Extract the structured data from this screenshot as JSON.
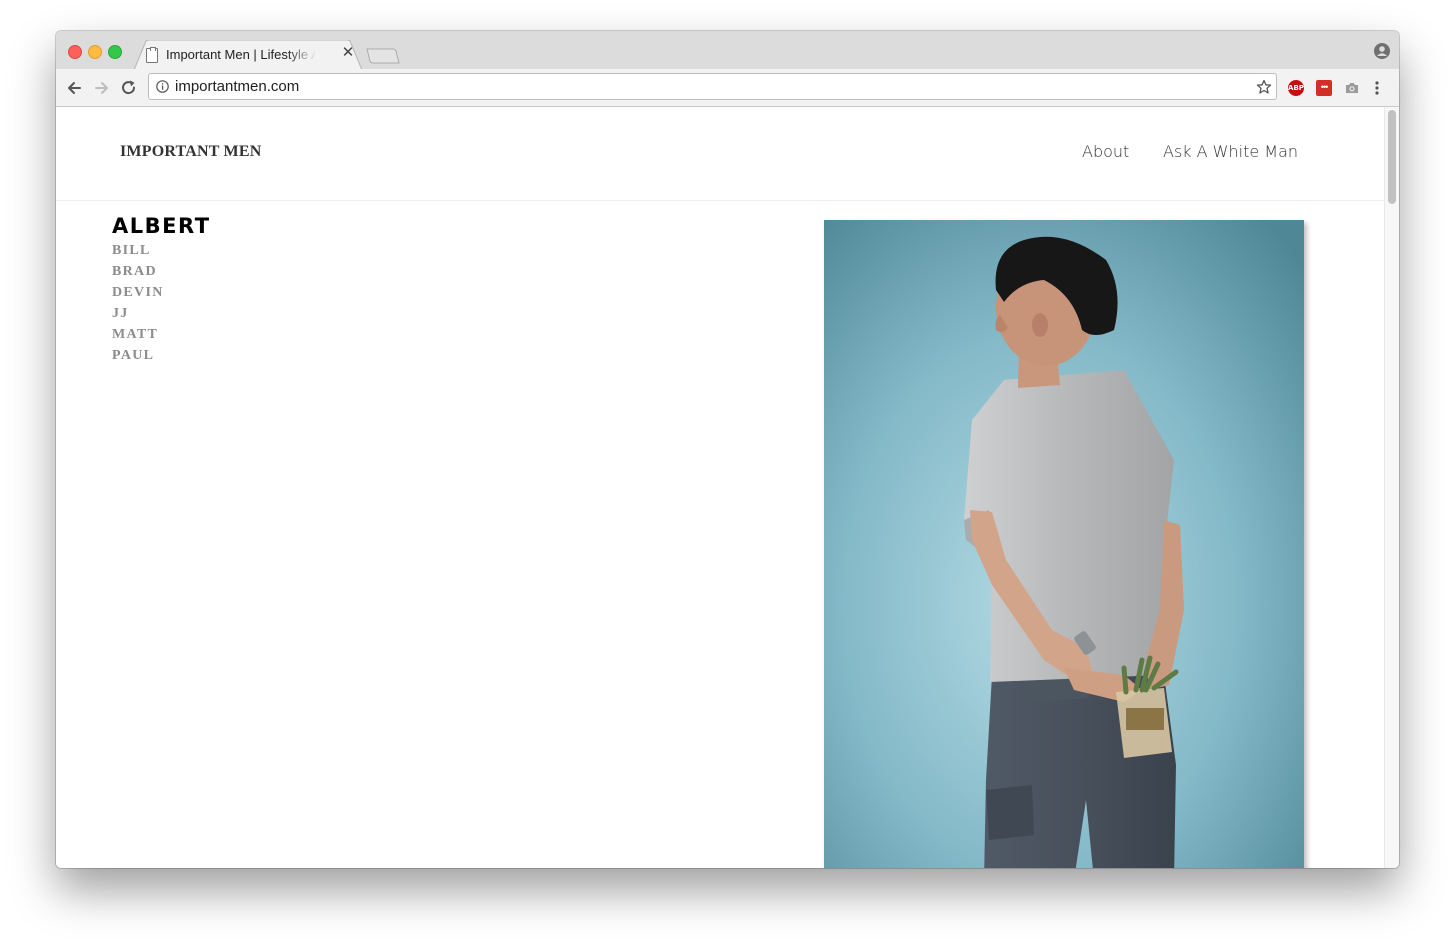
{
  "browser": {
    "tab_title": "Important Men | Lifestyle Attributes",
    "tab_close": "✕",
    "url": "importantmen.com",
    "extensions": {
      "abp_label": "ABP",
      "lastpass_label": "•••"
    }
  },
  "site": {
    "logo": "IMPORTANT MEN",
    "nav": [
      "About",
      "Ask A White Man"
    ]
  },
  "people": {
    "active": "ALBERT",
    "others": [
      "BILL",
      "BRAD",
      "DEVIN",
      "JJ",
      "MATT",
      "PAUL"
    ]
  },
  "colors": {
    "photo_background": "#7fb4c4",
    "shirt": "#b9babb",
    "pants": "#4a535e"
  }
}
